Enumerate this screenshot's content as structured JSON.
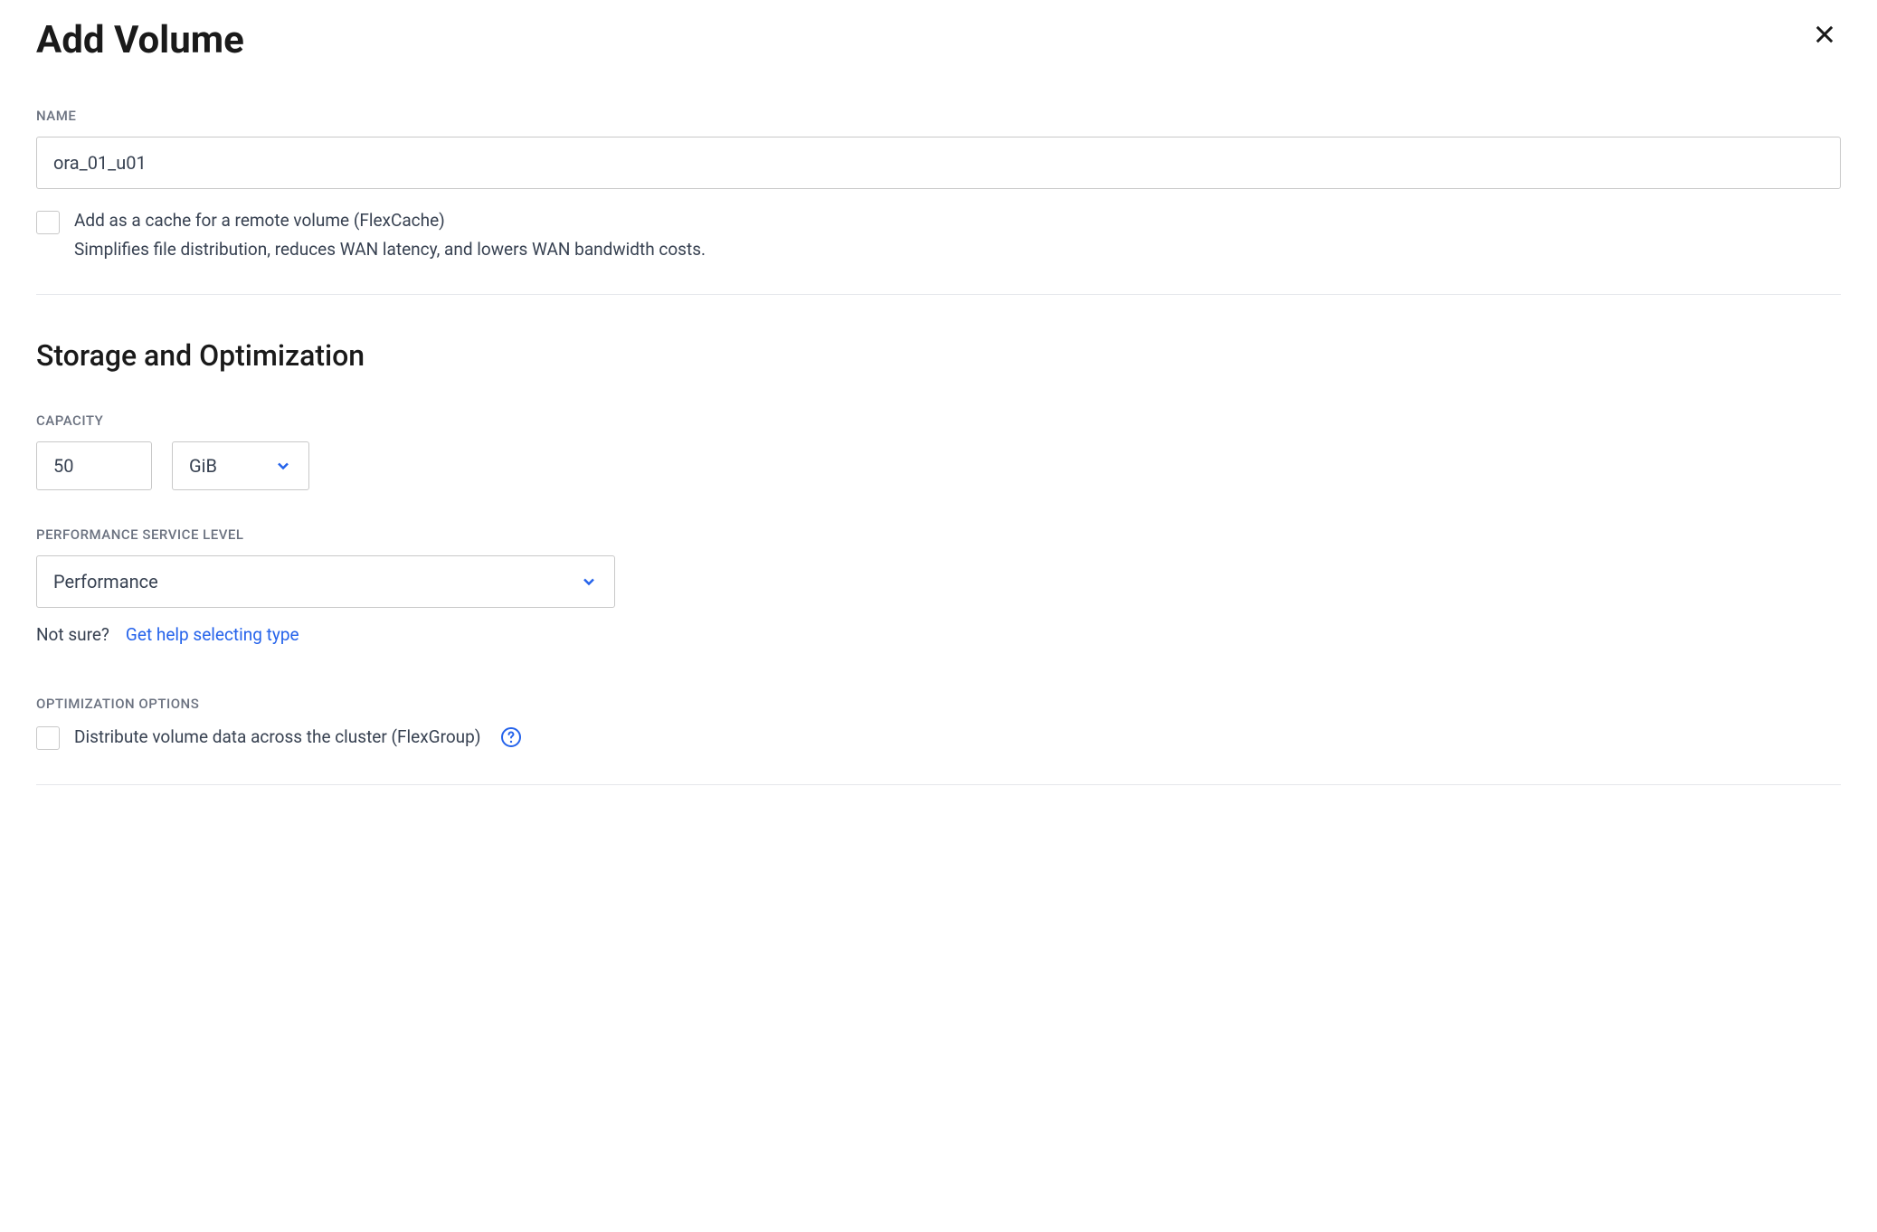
{
  "header": {
    "title": "Add Volume"
  },
  "name_section": {
    "label": "NAME",
    "value": "ora_01_u01",
    "flexcache": {
      "label": "Add as a cache for a remote volume (FlexCache)",
      "sublabel": "Simplifies file distribution, reduces WAN latency, and lowers WAN bandwidth costs."
    }
  },
  "storage_section": {
    "title": "Storage and Optimization",
    "capacity": {
      "label": "CAPACITY",
      "value": "50",
      "unit": "GiB"
    },
    "performance": {
      "label": "PERFORMANCE SERVICE LEVEL",
      "value": "Performance",
      "help_prefix": "Not sure?",
      "help_link": "Get help selecting type"
    },
    "optimization": {
      "label": "OPTIMIZATION OPTIONS",
      "flexgroup_label": "Distribute volume data across the cluster (FlexGroup)"
    }
  }
}
